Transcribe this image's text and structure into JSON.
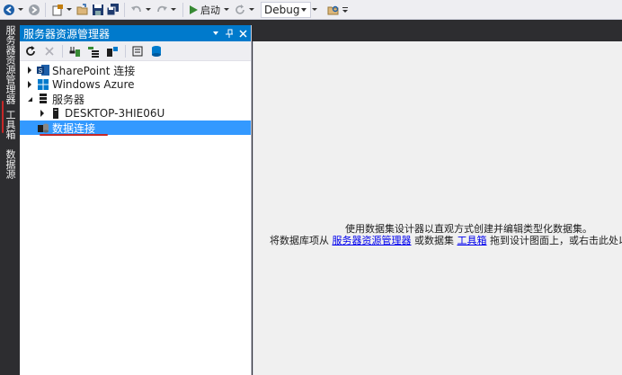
{
  "toolbar": {
    "start_label": "启动",
    "config_value": "Debug"
  },
  "side_tabs": {
    "server_explorer": "服务器资源管理器",
    "toolbox": "工具箱",
    "data_sources": "数据源"
  },
  "server_explorer": {
    "title": "服务器资源管理器",
    "tree": [
      {
        "label": "SharePoint 连接",
        "icon": "sharepoint-icon",
        "expanded": false
      },
      {
        "label": "Windows Azure",
        "icon": "windows-azure-icon",
        "expanded": false
      },
      {
        "label": "服务器",
        "icon": "server-icon",
        "expanded": true
      },
      {
        "label": "DESKTOP-3HIE06U",
        "icon": "computer-icon",
        "expanded": false
      },
      {
        "label": "数据连接",
        "icon": "data-connection-icon",
        "selected": true
      }
    ]
  },
  "designer": {
    "line1": "使用数据集设计器以直观方式创建并编辑类型化数据集。",
    "line2_prefix": "将数据库项从",
    "link_server_explorer": "服务器资源管理器",
    "line2_middle": "或数据集",
    "link_toolbox": "工具箱",
    "line2_suffix": "拖到设计图面上，或右击此处以添加"
  },
  "colors": {
    "accent": "#007acc",
    "selection": "#3399ff",
    "annotation_red": "#c62828",
    "link": "#0000ee"
  }
}
